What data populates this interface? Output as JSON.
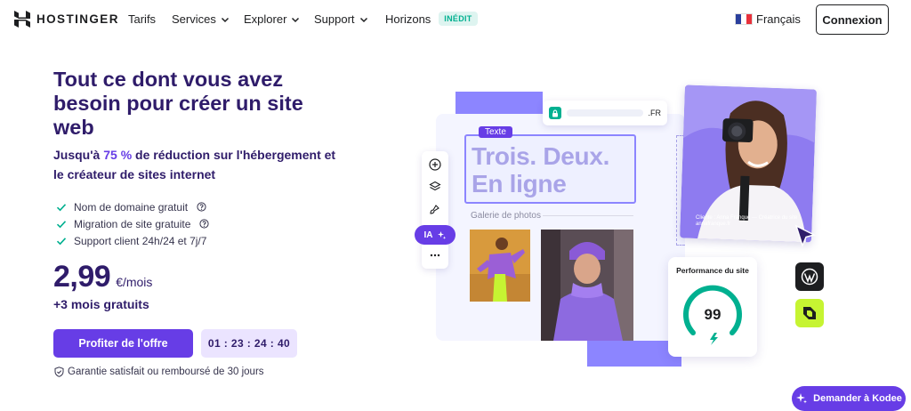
{
  "brand": {
    "name": "HOSTINGER"
  },
  "nav": {
    "items": [
      {
        "label": "Tarifs"
      },
      {
        "label": "Services"
      },
      {
        "label": "Explorer"
      },
      {
        "label": "Support"
      },
      {
        "label": "Horizons",
        "badge": "INÉDIT"
      }
    ],
    "language": "Français",
    "login": "Connexion"
  },
  "hero": {
    "title": "Tout ce dont vous avez besoin pour créer un site web",
    "subtitle_prefix": "Jusqu'à ",
    "subtitle_accent": "75 %",
    "subtitle_suffix": " de réduction sur l'hébergement et le créateur de sites internet",
    "features": [
      {
        "label": "Nom de domaine gratuit",
        "help": true
      },
      {
        "label": "Migration de site gratuite",
        "help": true
      },
      {
        "label": "Support client 24h/24 et 7j/7",
        "help": false
      }
    ],
    "price": "2,99",
    "price_unit": "€/mois",
    "bonus": "+3 mois gratuits",
    "cta": "Profiter de l'offre",
    "timer": "01 : 23 : 24 : 40",
    "guarantee": "Garantie satisfait ou remboursé de 30 jours"
  },
  "illustration": {
    "url_tld": ".FR",
    "text_tag": "Texte",
    "headline": "Trois. Deux. En ligne",
    "gallery_label": "Galerie de photos",
    "ia_label": "IA",
    "caption": "Cliente : Anna Franque — Créatrice du site annafranque.fr",
    "perf_title": "Performance du site",
    "perf_score": "99"
  },
  "chat": {
    "label": "Demander à Kodee"
  },
  "colors": {
    "primary": "#673de6",
    "navy": "#2f1c6a",
    "accent_green": "#00b090",
    "lime": "#c6f432"
  }
}
